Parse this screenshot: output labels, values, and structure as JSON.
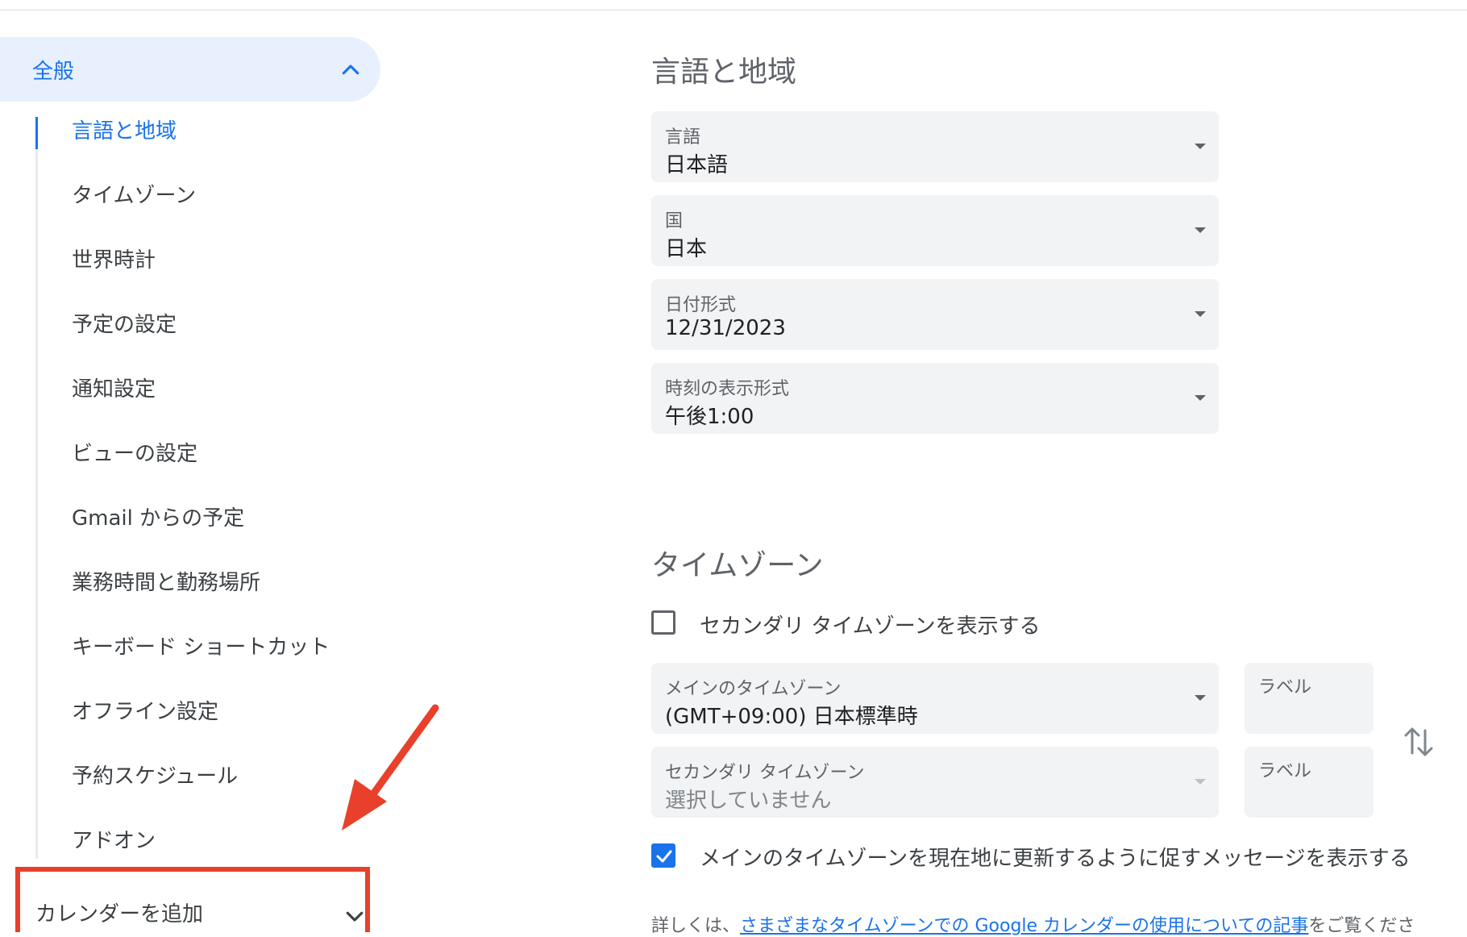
{
  "sidebar": {
    "general_label": "全般",
    "items": [
      {
        "label": "言語と地域",
        "active": true
      },
      {
        "label": "タイムゾーン"
      },
      {
        "label": "世界時計"
      },
      {
        "label": "予定の設定"
      },
      {
        "label": "通知設定"
      },
      {
        "label": "ビューの設定"
      },
      {
        "label": "Gmail からの予定"
      },
      {
        "label": "業務時間と勤務場所"
      },
      {
        "label": "キーボード ショートカット"
      },
      {
        "label": "オフライン設定"
      },
      {
        "label": "予約スケジュール"
      },
      {
        "label": "アドオン"
      }
    ],
    "add_calendar_label": "カレンダーを追加"
  },
  "language_region": {
    "title": "言語と地域",
    "fields": [
      {
        "label": "言語",
        "value": "日本語"
      },
      {
        "label": "国",
        "value": "日本"
      },
      {
        "label": "日付形式",
        "value": "12/31/2023"
      },
      {
        "label": "時刻の表示形式",
        "value": "午後1:00"
      }
    ]
  },
  "timezone": {
    "title": "タイムゾーン",
    "secondary_checkbox_label": "セカンダリ タイムゾーンを表示する",
    "secondary_checked": false,
    "primary": {
      "label": "メインのタイムゾーン",
      "value": "(GMT+09:00) 日本標準時",
      "label_field": "ラベル"
    },
    "secondary": {
      "label": "セカンダリ タイムゾーン",
      "value": "選択していません",
      "label_field": "ラベル"
    },
    "prompt_checkbox_label": "メインのタイムゾーンを現在地に更新するように促すメッセージを表示する",
    "prompt_checked": true,
    "info_prefix": "詳しくは、",
    "info_link": "さまざまなタイムゾーンでの Google カレンダーの使用についての記事",
    "info_suffix": "をご覧くださ"
  },
  "icons": {
    "general_chevron": "chevron-up-icon",
    "add_calendar_chevron": "chevron-down-icon",
    "swap": "swap-vertical-icon",
    "annotation": "red-arrow-annotation"
  },
  "colors": {
    "accent": "#1a73e8",
    "annotation": "#e8402a",
    "field_bg": "#f1f3f4"
  }
}
